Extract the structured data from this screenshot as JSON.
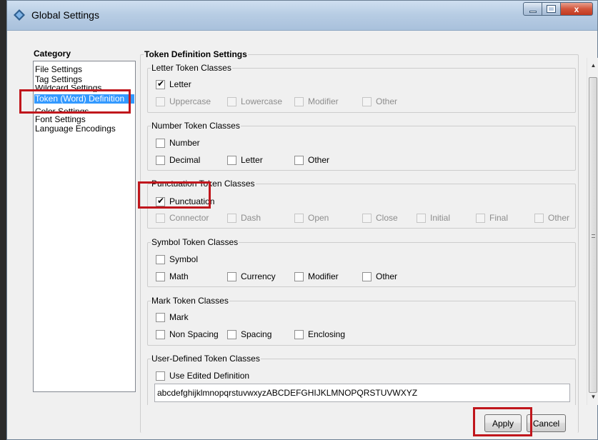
{
  "window": {
    "title": "Global Settings",
    "controls": {
      "minimize": "–",
      "maximize": "□",
      "close": "x"
    }
  },
  "category": {
    "label": "Category",
    "items": [
      "File Settings",
      "Tag Settings",
      "Wildcard Settings",
      "Token (Word) Definition",
      "Color Settings",
      "Font Settings",
      "Language Encodings"
    ],
    "selected_index": 3
  },
  "token_settings": {
    "title": "Token Definition Settings",
    "letter": {
      "title": "Letter Token Classes",
      "main": {
        "label": "Letter",
        "checked": true
      },
      "sub": [
        "Uppercase",
        "Lowercase",
        "Modifier",
        "Other"
      ]
    },
    "number": {
      "title": "Number Token Classes",
      "main": {
        "label": "Number",
        "checked": false
      },
      "sub": [
        "Decimal",
        "Letter",
        "Other"
      ]
    },
    "punctuation": {
      "title": "Punctuation Token Classes",
      "main": {
        "label": "Punctuation",
        "checked": true
      },
      "sub": [
        "Connector",
        "Dash",
        "Open",
        "Close",
        "Initial",
        "Final",
        "Other"
      ]
    },
    "symbol": {
      "title": "Symbol Token Classes",
      "main": {
        "label": "Symbol",
        "checked": false
      },
      "sub": [
        "Math",
        "Currency",
        "Modifier",
        "Other"
      ]
    },
    "mark": {
      "title": "Mark Token Classes",
      "main": {
        "label": "Mark",
        "checked": false
      },
      "sub": [
        "Non Spacing",
        "Spacing",
        "Enclosing"
      ]
    },
    "user_defined": {
      "title": "User-Defined Token Classes",
      "main": {
        "label": "Use Edited Definition",
        "checked": false
      },
      "definition": "abcdefghijklmnopqrstuvwxyzABCDEFGHIJKLMNOPQRSTUVWXYZ"
    }
  },
  "buttons": {
    "apply": "Apply",
    "cancel": "Cancel"
  },
  "colors": {
    "highlight": "#c0161c",
    "selection": "#3399ff"
  }
}
